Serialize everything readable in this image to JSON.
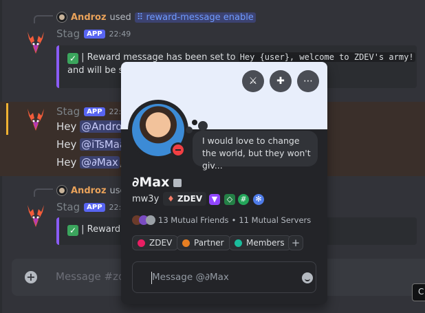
{
  "messages": {
    "first": {
      "reply_user": "Androz",
      "reply_used": "used",
      "reply_command": "reward-message enable",
      "author": "Stag",
      "app_badge": "APP",
      "time": "22:49",
      "embed_prefix": "| Reward message has been set to",
      "embed_code": "Hey {user}, welcome to ZDEV's army!",
      "embed_line2": "and will be se"
    },
    "second": {
      "author": "Stag",
      "app_badge": "APP",
      "time": "22:",
      "lines": [
        {
          "hey": "Hey",
          "mention": "@Androz"
        },
        {
          "hey": "Hey",
          "mention": "@iTsMaa"
        },
        {
          "hey": "Hey",
          "mention": "@∂Max",
          "tail": ","
        }
      ]
    },
    "third": {
      "reply_user": "Androz",
      "reply_used": "used",
      "author": "Stag",
      "app_badge": "APP",
      "time": "22:",
      "embed_prefix": "| Reward r"
    }
  },
  "chat_input": {
    "placeholder": "Message #zde",
    "corner_label": "C"
  },
  "profile": {
    "status_note": "I would love to change the world, but they won't giv...",
    "display_name": "∂Max",
    "username": "mw3y",
    "server_tag": "ZDEV",
    "mutual_friends": "13 Mutual Friends",
    "separator": "•",
    "mutual_servers": "11 Mutual Servers",
    "roles": [
      {
        "name": "ZDEV",
        "color": "#e91e63"
      },
      {
        "name": "Partner",
        "color": "#e67e22"
      },
      {
        "name": "Members",
        "color": "#1abc9c"
      }
    ],
    "add_role": "+",
    "message_placeholder": "Message @∂Max"
  },
  "icons": {
    "banner_buttons": [
      "swords-icon",
      "add-friend-icon",
      "more-icon"
    ],
    "badges": [
      "twitch-badge-icon",
      "developer-badge-icon",
      "hashtag-badge-icon",
      "gear-badge-icon"
    ]
  },
  "colors": {
    "accent": "#5865f2",
    "embed_border": "#8a5cf5",
    "mention": "#c9cdfb",
    "dnd": "#f23f43",
    "reply_name": "#e9a25a"
  }
}
